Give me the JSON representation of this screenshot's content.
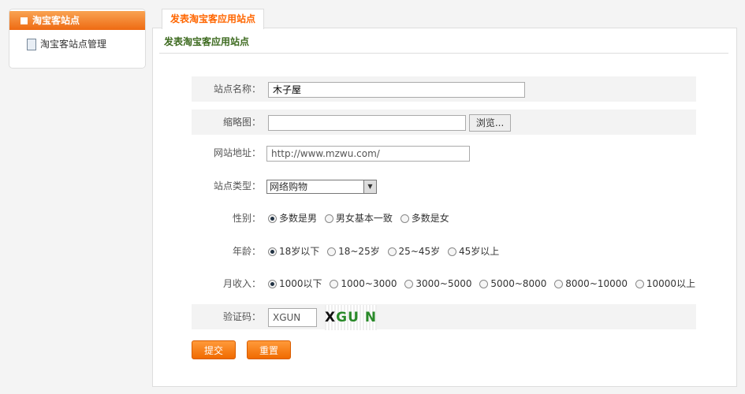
{
  "sidebar": {
    "header": "淘宝客站点",
    "items": [
      {
        "label": "淘宝客站点管理"
      }
    ]
  },
  "tab": {
    "label": "发表淘宝客应用站点"
  },
  "form": {
    "title": "发表淘宝客应用站点",
    "name": {
      "label": "站点名称：",
      "value": "木子屋"
    },
    "thumb": {
      "label": "缩略图：",
      "value": "",
      "browse": "浏览..."
    },
    "url": {
      "label": "网站地址：",
      "value": "http://www.mzwu.com/"
    },
    "type": {
      "label": "站点类型：",
      "selected": "网络购物"
    },
    "gender": {
      "label": "性别：",
      "options": [
        "多数是男",
        "男女基本一致",
        "多数是女"
      ],
      "selected": 0
    },
    "age": {
      "label": "年龄：",
      "options": [
        "18岁以下",
        "18~25岁",
        "25~45岁",
        "45岁以上"
      ],
      "selected": 0
    },
    "income": {
      "label": "月收入：",
      "options": [
        "1000以下",
        "1000~3000",
        "3000~5000",
        "5000~8000",
        "8000~10000",
        "10000以上"
      ],
      "selected": 0
    },
    "captcha": {
      "label": "验证码：",
      "value": "XGUN",
      "image_text": [
        "X",
        "G",
        "U",
        "N"
      ],
      "colors": [
        "#111",
        "#2a8a2a",
        "#2a8a2a",
        "#2a8a2a"
      ]
    },
    "submit": "提交",
    "reset": "重置"
  }
}
